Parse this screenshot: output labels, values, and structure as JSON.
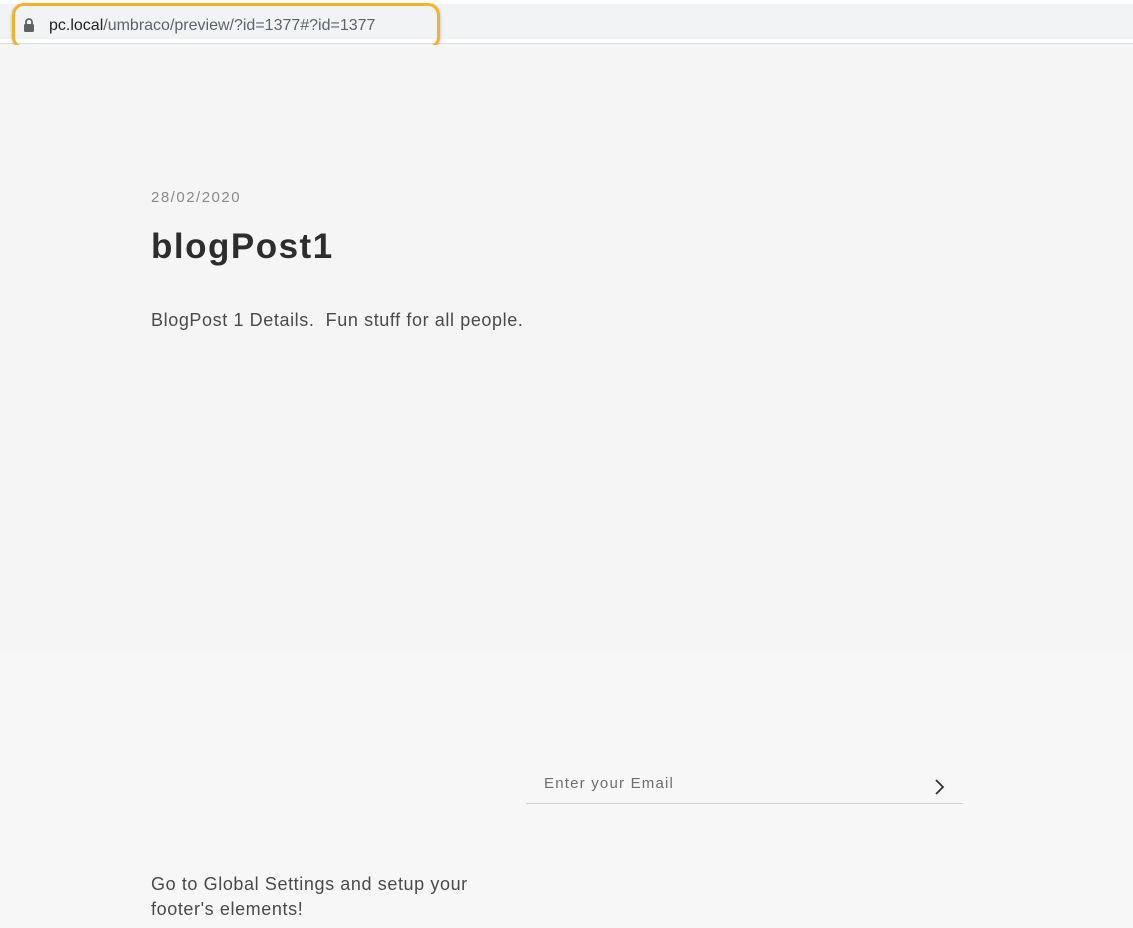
{
  "browser": {
    "url_host": "pc.local",
    "url_path": "/umbraco/preview/?id=1377#?id=1377"
  },
  "post": {
    "date": "28/02/2020",
    "title": "blogPost1",
    "body": "BlogPost 1 Details.  Fun stuff for all people."
  },
  "footer": {
    "email_placeholder": "Enter your Email",
    "submit_icon": "chevron-right-icon",
    "setup_text": "Go to Global Settings and setup your footer's elements!"
  },
  "colors": {
    "highlight": "#f0b429"
  }
}
